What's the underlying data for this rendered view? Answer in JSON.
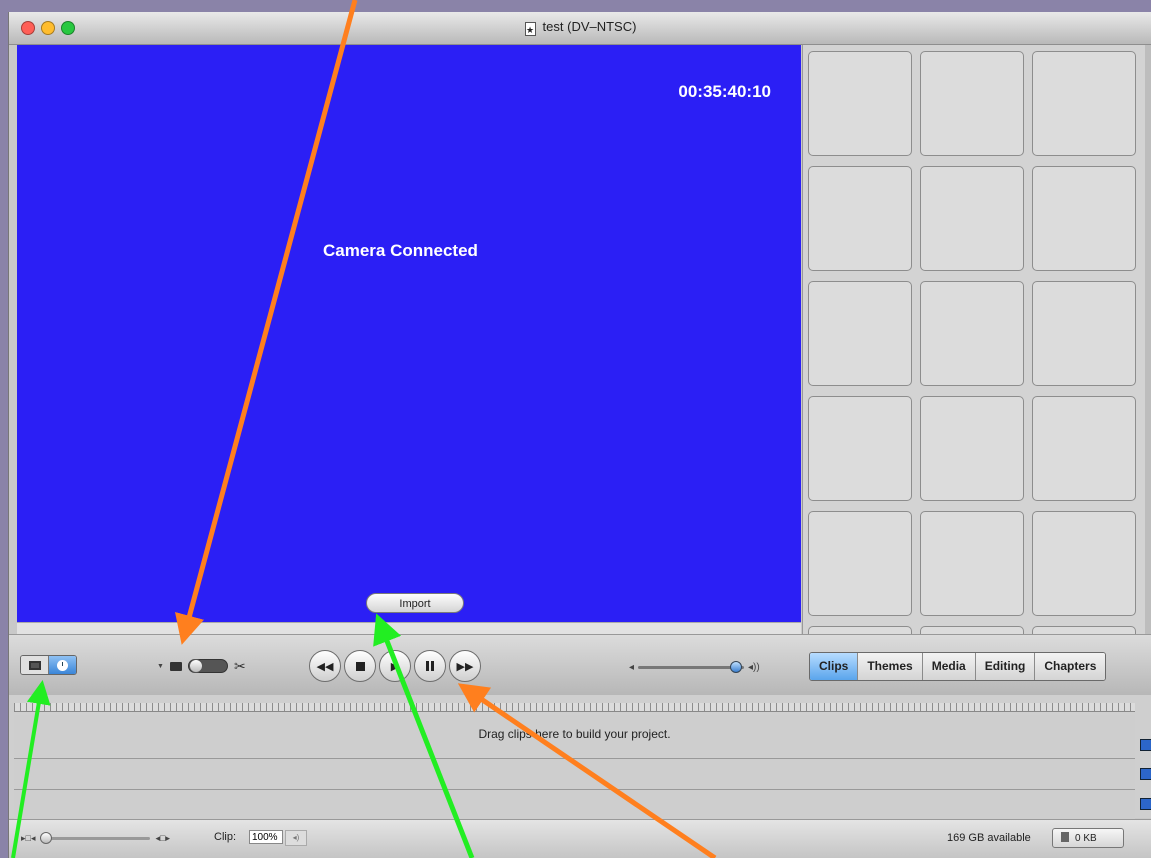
{
  "window": {
    "title": "test (DV–NTSC)",
    "traffic_lights": {
      "close": "#ff5f57",
      "minimize": "#ffbd2e",
      "zoom": "#28c840"
    }
  },
  "viewer": {
    "background": "#2b1ff5",
    "timecode": "00:35:40:10",
    "status": "Camera Connected",
    "import_label": "Import"
  },
  "clips_panel": {
    "cell_count": 18
  },
  "toolbar": {
    "mode_clip_icon": "film-strip-icon",
    "mode_time_icon": "clock-icon",
    "camera_icon": "camera-icon",
    "edit_icon": "scissors-icon",
    "transport": {
      "rewind": "◀◀",
      "fast_forward": "▶▶"
    },
    "tabs": [
      "Clips",
      "Themes",
      "Media",
      "Editing",
      "Chapters"
    ],
    "active_tab": "Clips"
  },
  "timeline": {
    "message": "Drag clips here to build your project."
  },
  "statusbar": {
    "clip_label": "Clip:",
    "clip_value": "100%",
    "available": "169 GB available",
    "trash": "0 KB"
  },
  "annotations": {
    "orange": "#ff7f1e",
    "green": "#22ee22"
  }
}
